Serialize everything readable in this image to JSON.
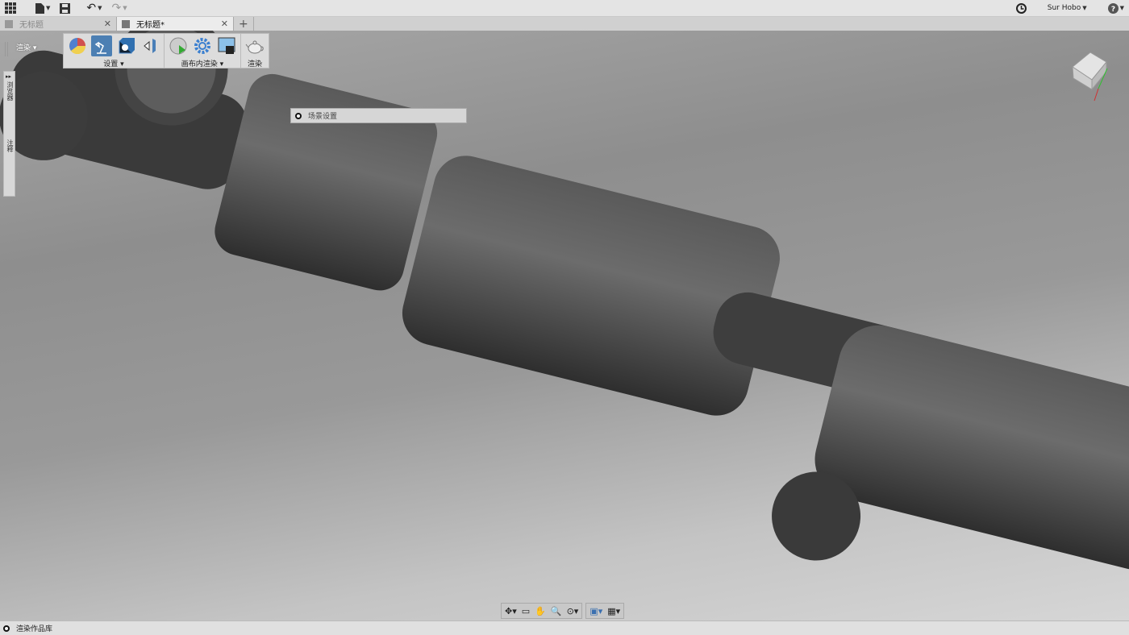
{
  "top_bar": {
    "user": "Sur Hobo"
  },
  "tabs": [
    {
      "label": "无标题",
      "active": false
    },
    {
      "label": "无标题*",
      "active": true
    }
  ],
  "ribbon": {
    "workspace": "渲染",
    "groups": [
      {
        "label": "设置"
      },
      {
        "label": "画布内渲染"
      },
      {
        "label": "渲染"
      }
    ]
  },
  "browser_panel": {
    "browser_label": "浏览器",
    "comments_label": "注释"
  },
  "scene_settings": {
    "label": "场景设置"
  },
  "status_bar": {
    "label": "渲染作品库"
  },
  "colors": {
    "accent": "#4c7fb3",
    "axis_x": "#d03030",
    "axis_y": "#30c030"
  }
}
